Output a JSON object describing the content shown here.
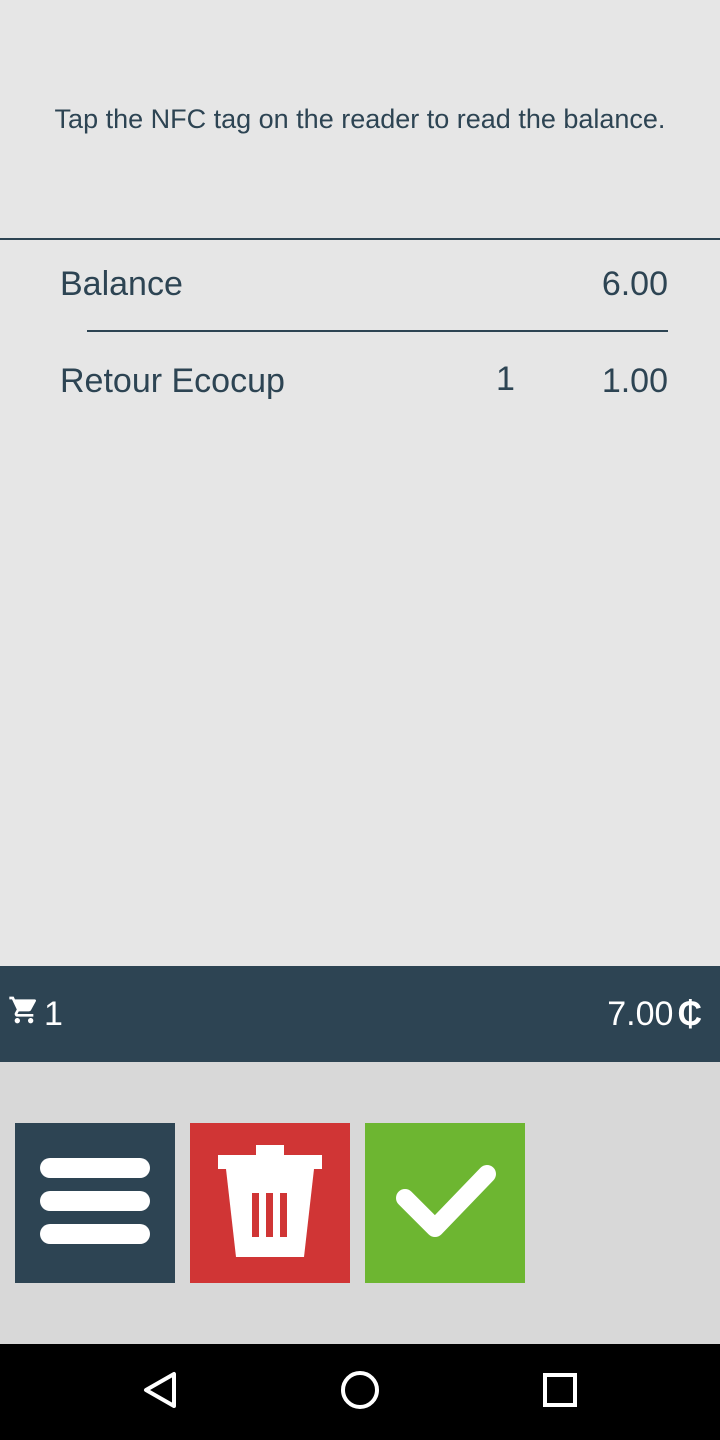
{
  "instructions": "Tap the NFC tag on the reader to read the balance.",
  "balance": {
    "label": "Balance",
    "value": "6.00"
  },
  "items": [
    {
      "label": "Retour Ecocup",
      "qty": "1",
      "amount": "1.00"
    }
  ],
  "cart": {
    "count": "1",
    "total": "7.00",
    "currency_symbol": "₵"
  },
  "actions": {
    "menu_icon": "menu-icon",
    "delete_icon": "trash-icon",
    "confirm_icon": "check-icon"
  },
  "colors": {
    "primary": "#2d4453",
    "danger": "#d03535",
    "success": "#6db631",
    "background": "#e6e6e6"
  },
  "system_nav": [
    "back",
    "home",
    "recents"
  ]
}
